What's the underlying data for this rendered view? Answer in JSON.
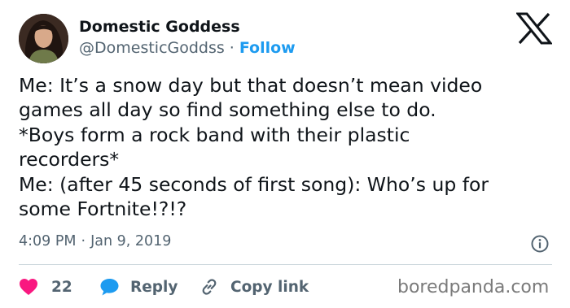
{
  "author": {
    "name": "Domestic Goddess",
    "handle": "@DomesticGoddss",
    "separator": "·",
    "follow_label": "Follow"
  },
  "tweet": {
    "lines": [
      "Me: It’s a snow day but that doesn’t mean video",
      "games all day so find something else to do.",
      "*Boys form a rock band with their plastic",
      "recorders*",
      "Me: (after 45 seconds of first song): Who’s up for",
      "some Fortnite!?!?"
    ],
    "time": "4:09 PM",
    "separator": "·",
    "date": "Jan 9, 2019"
  },
  "actions": {
    "like_count": "22",
    "reply_label": "Reply",
    "copy_link_label": "Copy link"
  },
  "icons": {
    "platform": "x-logo-icon",
    "info": "info-icon",
    "like": "heart-icon",
    "reply": "speech-bubble-icon",
    "copy_link": "link-icon"
  },
  "watermark": "boredpanda.com",
  "colors": {
    "text": "#0f1419",
    "secondary": "#536471",
    "accent": "#1d9bf0",
    "like": "#f91880",
    "divider": "#cfd9de"
  }
}
